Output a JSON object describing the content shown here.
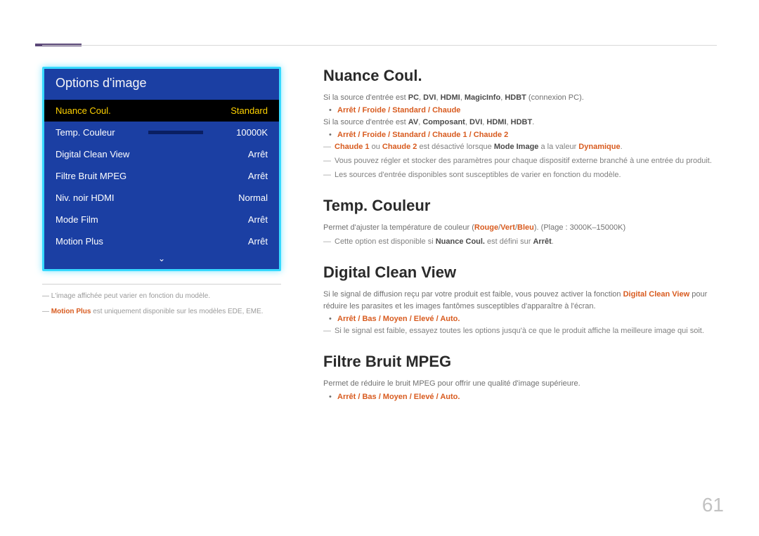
{
  "pageNumber": "61",
  "menu": {
    "title": "Options d'image",
    "selected": {
      "label": "Nuance Coul.",
      "value": "Standard"
    },
    "items": [
      {
        "label": "Temp. Couleur",
        "value": "10000K",
        "slider": true
      },
      {
        "label": "Digital Clean View",
        "value": "Arrêt"
      },
      {
        "label": "Filtre Bruit MPEG",
        "value": "Arrêt"
      },
      {
        "label": "Niv. noir HDMI",
        "value": "Normal"
      },
      {
        "label": "Mode Film",
        "value": "Arrêt"
      },
      {
        "label": "Motion Plus",
        "value": "Arrêt"
      }
    ],
    "downIndicator": "⌄"
  },
  "footnotes": {
    "note1_pre": "― ",
    "note1": "L'image affichée peut varier en fonction du modèle.",
    "note2_pre": "― ",
    "note2_bold": "Motion Plus",
    "note2_rest": " est uniquement disponible sur les modèles EDE, EME."
  },
  "sections": {
    "nuance": {
      "title": "Nuance Coul.",
      "p1_a": "Si la source d'entrée est ",
      "p1_b1": "PC",
      "p1_c1": ", ",
      "p1_b2": "DVI",
      "p1_c2": ", ",
      "p1_b3": "HDMI",
      "p1_c3": ", ",
      "p1_b4": "MagicInfo",
      "p1_c4": ", ",
      "p1_b5": "HDBT",
      "p1_c5": " (connexion PC).",
      "bullet1": "Arrêt / Froide / Standard / Chaude",
      "p2_a": "Si la source d'entrée est ",
      "p2_b1": "AV",
      "p2_c1": ", ",
      "p2_b2": "Composant",
      "p2_c2": ", ",
      "p2_b3": "DVI",
      "p2_c3": ", ",
      "p2_b4": "HDMI",
      "p2_c4": ", ",
      "p2_b5": "HDBT",
      "p2_c5": ".",
      "bullet2": "Arrêt / Froide / Standard / Chaude 1 / Chaude 2",
      "n1_a": "Chaude 1",
      "n1_b": " ou ",
      "n1_c": "Chaude 2",
      "n1_d": " est désactivé lorsque ",
      "n1_e": "Mode Image",
      "n1_f": " a la valeur ",
      "n1_g": "Dynamique",
      "n1_h": ".",
      "n2": "Vous pouvez régler et stocker des paramètres pour chaque dispositif externe branché à une entrée du produit.",
      "n3": "Les sources d'entrée disponibles sont susceptibles de varier en fonction du modèle."
    },
    "temp": {
      "title": "Temp. Couleur",
      "p1_a": "Permet d'ajuster la température de couleur (",
      "p1_b": "Rouge",
      "p1_c": "/",
      "p1_d": "Vert",
      "p1_e": "/",
      "p1_f": "Bleu",
      "p1_g": "). (Plage : 3000K–15000K)",
      "n1_a": "Cette option est disponible si ",
      "n1_b": "Nuance Coul.",
      "n1_c": " est défini sur ",
      "n1_d": "Arrêt",
      "n1_e": "."
    },
    "dcv": {
      "title": "Digital Clean View",
      "p1_a": "Si le signal de diffusion reçu par votre produit est faible, vous pouvez activer la fonction ",
      "p1_b": "Digital Clean View",
      "p1_c": " pour réduire les parasites et les images fantômes susceptibles d'apparaître à l'écran.",
      "bullet1": "Arrêt / Bas / Moyen / Elevé / Auto.",
      "n1": "Si le signal est faible, essayez toutes les options jusqu'à ce que le produit affiche la meilleure image qui soit."
    },
    "mpeg": {
      "title": "Filtre Bruit MPEG",
      "p1": "Permet de réduire le bruit MPEG pour offrir une qualité d'image supérieure.",
      "bullet1": "Arrêt / Bas / Moyen / Elevé / Auto."
    }
  }
}
